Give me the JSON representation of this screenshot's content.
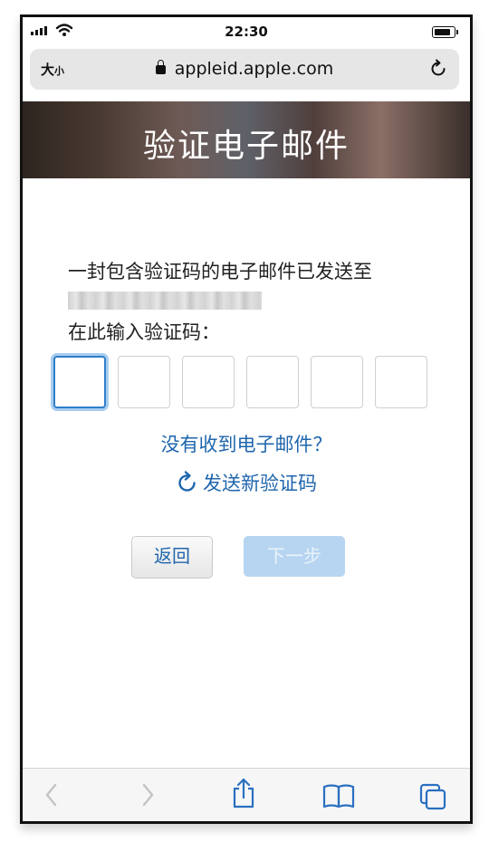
{
  "status": {
    "time": "22:30"
  },
  "browser": {
    "text_size_label": "大",
    "text_size_small": "小",
    "url": "appleid.apple.com"
  },
  "page": {
    "title": "验证电子邮件",
    "message": "一封包含验证码的电子邮件已发送至",
    "enter_prompt": "在此输入验证码：",
    "no_email_link": "没有收到电子邮件？",
    "resend_link": "发送新验证码",
    "back_button": "返回",
    "next_button": "下一步"
  },
  "colors": {
    "link": "#1f66ad",
    "active_field": "#2f7fc9",
    "disabled_button": "#b7d5f1"
  },
  "icons": [
    "lock-icon",
    "reload-icon",
    "refresh-icon",
    "back-arrow-icon",
    "forward-arrow-icon",
    "share-icon",
    "bookmarks-icon",
    "tabs-icon"
  ]
}
